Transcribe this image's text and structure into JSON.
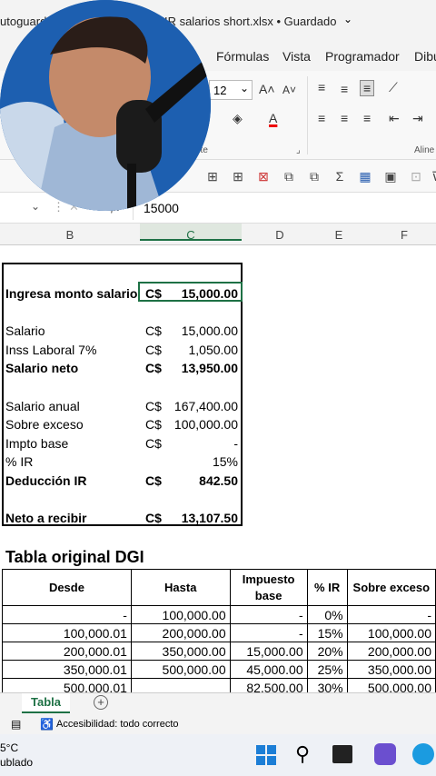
{
  "window": {
    "title_left": "utoguard",
    "title_right": "ulo IR salarios short.xlsx • Guardado",
    "chevron": "chevron-down-icon"
  },
  "ribbon_tabs": [
    "Fórmulas",
    "Vista",
    "Programador",
    "Dibu"
  ],
  "ribbon": {
    "font_size": "12",
    "font_group_label": "nte",
    "alignment_group_label": "Aline"
  },
  "formula_bar": {
    "fx": "fx",
    "value": "15000"
  },
  "column_headers": [
    "B",
    "C",
    "D",
    "E",
    "F"
  ],
  "calc_box": {
    "rows": [
      {
        "label": "Ingresa monto salario",
        "currency": "C$",
        "value": "15,000.00",
        "bold": true
      },
      {
        "label": "",
        "currency": "",
        "value": "",
        "bold": false
      },
      {
        "label": "Salario",
        "currency": "C$",
        "value": "15,000.00",
        "bold": false
      },
      {
        "label": "Inss Laboral 7%",
        "currency": "C$",
        "value": "1,050.00",
        "bold": false
      },
      {
        "label": "Salario neto",
        "currency": "C$",
        "value": "13,950.00",
        "bold": true
      },
      {
        "label": "",
        "currency": "",
        "value": "",
        "bold": false
      },
      {
        "label": "Salario anual",
        "currency": "C$",
        "value": "167,400.00",
        "bold": false
      },
      {
        "label": "Sobre exceso",
        "currency": "C$",
        "value": "100,000.00",
        "bold": false
      },
      {
        "label": "Impto base",
        "currency": "C$",
        "value": "-",
        "bold": false
      },
      {
        "label": "% IR",
        "currency": "",
        "value": "15%",
        "bold": false
      },
      {
        "label": "Deducción IR",
        "currency": "C$",
        "value": "842.50",
        "bold": true
      },
      {
        "label": "",
        "currency": "",
        "value": "",
        "bold": false
      },
      {
        "label": "Neto a recibir",
        "currency": "C$",
        "value": "13,107.50",
        "bold": true
      }
    ]
  },
  "dgi_table": {
    "title": "Tabla original DGI",
    "headers": [
      "Desde",
      "Hasta",
      "Impuesto base",
      "% IR",
      "Sobre exceso"
    ],
    "rows": [
      [
        "-",
        "100,000.00",
        "-",
        "0%",
        "-"
      ],
      [
        "100,000.01",
        "200,000.00",
        "-",
        "15%",
        "100,000.00"
      ],
      [
        "200,000.01",
        "350,000.00",
        "15,000.00",
        "20%",
        "200,000.00"
      ],
      [
        "350,000.01",
        "500,000.00",
        "45,000.00",
        "25%",
        "350,000.00"
      ],
      [
        "500,000.01",
        "",
        "82,500.00",
        "30%",
        "500,000.00"
      ]
    ]
  },
  "sheet_tabs": {
    "active": "Tabla",
    "add": "+"
  },
  "status": {
    "accessibility": "Accesibilidad: todo correcto"
  },
  "taskbar": {
    "temp": "5°C",
    "weather": "ublado"
  },
  "colors": {
    "excel_green": "#1e7145",
    "ribbon_bg": "#f8f8f8"
  }
}
